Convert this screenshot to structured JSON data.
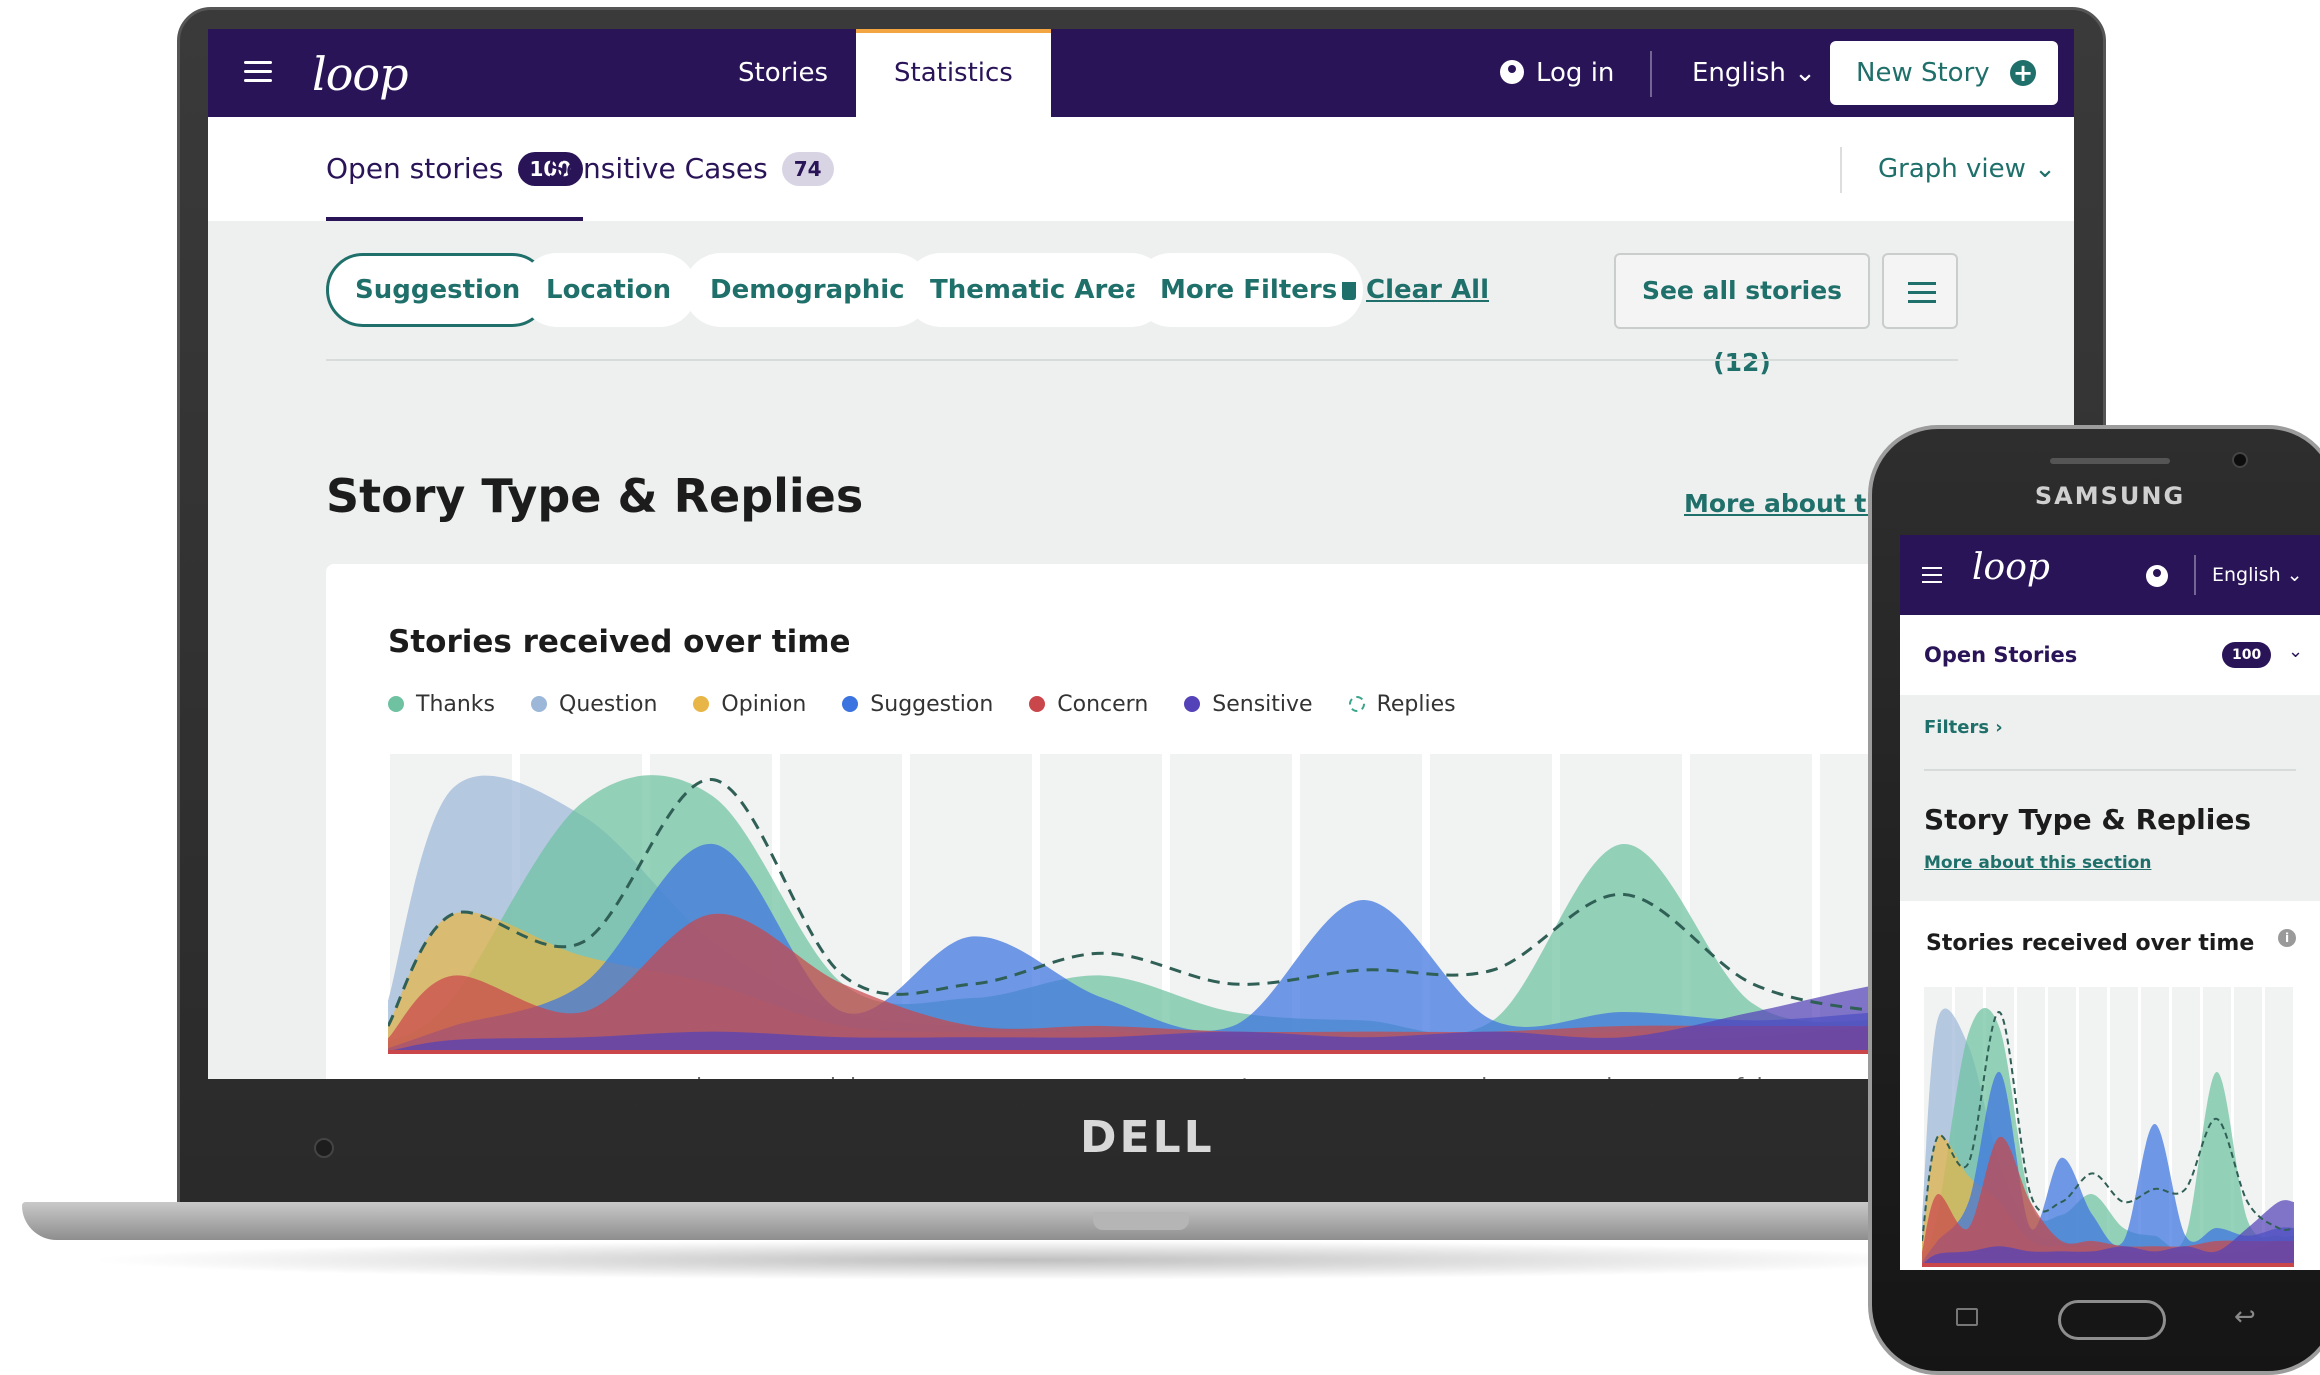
{
  "laptop": {
    "brand": "DELL",
    "nav": {
      "logo": "loop",
      "tabs": [
        {
          "label": "Stories",
          "active": false
        },
        {
          "label": "Statistics",
          "active": true
        }
      ],
      "login": "Log in",
      "language": "English ⌄",
      "new_story": "New Story"
    },
    "subtabs": [
      {
        "label": "Open stories",
        "count": "100"
      },
      {
        "label": "Sensitive Cases",
        "count": "74"
      }
    ],
    "graph_view": "Graph view ⌄",
    "filters": {
      "chips": [
        "Suggestion",
        "Location",
        "Demographic",
        "Thematic Area",
        "More Filters"
      ],
      "clear_all": "Clear All",
      "see_all": "See all stories (12)"
    },
    "section_title": "Story Type & Replies",
    "more_about": "More about this",
    "card_title": "Stories received over time",
    "legend": [
      {
        "label": "Thanks",
        "color": "#6fc2a1"
      },
      {
        "label": "Question",
        "color": "#9db7d8"
      },
      {
        "label": "Opinion",
        "color": "#e8b646"
      },
      {
        "label": "Suggestion",
        "color": "#3b73e0"
      },
      {
        "label": "Concern",
        "color": "#c9474b"
      },
      {
        "label": "Sensitive",
        "color": "#5443b8"
      },
      {
        "label": "Replies",
        "color": "#3aa58a"
      }
    ]
  },
  "phone": {
    "brand": "SAMSUNG",
    "logo": "loop",
    "language": "English ⌄",
    "open_stories": "Open Stories",
    "count": "100",
    "filters": "Filters  ›",
    "section_title": "Story Type & Replies",
    "more_about": "More about this section",
    "card_title": "Stories received over time",
    "info": "i"
  },
  "colors": {
    "nav_bg": "#2a1458",
    "accent_teal": "#1f6f6a",
    "active_tab_border": "#f2a541"
  },
  "chart_data": {
    "type": "area",
    "x": [
      "apr",
      "may",
      "jun",
      "jul",
      "aug",
      "sep",
      "oct",
      "nov",
      "dec",
      "jan",
      "feb",
      "mar"
    ],
    "grid": true,
    "series": [
      {
        "name": "Question",
        "values": [
          9.5,
          8.5,
          4,
          1.5,
          1,
          0.8,
          0.6,
          0.6,
          0.5,
          0.5,
          0.6,
          1
        ]
      },
      {
        "name": "Thanks",
        "values": [
          2,
          9,
          9.2,
          2.5,
          2,
          2.8,
          1.5,
          1.2,
          1.2,
          7.5,
          1.8,
          1.2
        ]
      },
      {
        "name": "Opinion",
        "values": [
          5,
          3.5,
          2.5,
          1,
          0.8,
          0.8,
          0.6,
          0.6,
          0.6,
          0.8,
          0.8,
          1
        ]
      },
      {
        "name": "Suggestion",
        "values": [
          1,
          2.5,
          7.5,
          1.5,
          4.2,
          2,
          1,
          5.5,
          1.2,
          1.5,
          1.2,
          1.5
        ]
      },
      {
        "name": "Concern",
        "values": [
          2.8,
          1.5,
          5,
          2.5,
          1,
          1,
          0.8,
          0.8,
          0.8,
          1,
          1,
          1
        ]
      },
      {
        "name": "Sensitive",
        "values": [
          0.5,
          0.6,
          0.8,
          0.6,
          0.6,
          0.6,
          0.8,
          0.6,
          0.8,
          0.6,
          1.5,
          2.5
        ]
      },
      {
        "name": "Replies",
        "values": [
          5,
          4,
          9.8,
          2.8,
          2.5,
          3.6,
          2.5,
          3,
          3,
          5.7,
          2.5,
          1.5
        ]
      }
    ],
    "ylim": [
      0,
      10
    ]
  }
}
